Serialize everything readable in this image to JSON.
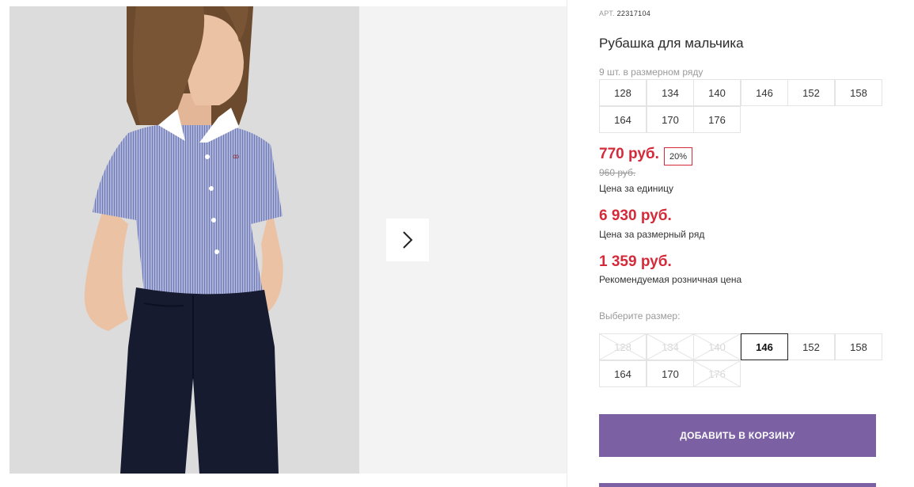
{
  "product": {
    "sku_label": "АРТ.",
    "sku_value": "22317104",
    "title": "Рубашка для мальчика",
    "pack_note": "9 шт. в размерном ряду",
    "pack_sizes": [
      "128",
      "134",
      "140",
      "146",
      "152",
      "158",
      "164",
      "170",
      "176"
    ],
    "unit_price": "770 руб.",
    "discount": "20%",
    "old_price": "960 руб.",
    "unit_price_caption": "Цена за единицу",
    "pack_price": "6 930 руб.",
    "pack_price_caption": "Цена за размерный ряд",
    "retail_price": "1 359 руб.",
    "retail_price_caption": "Рекомендуемая розничная цена",
    "choose_size_label": "Выберите размер:",
    "size_options": [
      {
        "label": "128",
        "state": "disabled"
      },
      {
        "label": "134",
        "state": "disabled"
      },
      {
        "label": "140",
        "state": "disabled"
      },
      {
        "label": "146",
        "state": "selected"
      },
      {
        "label": "152",
        "state": "available"
      },
      {
        "label": "158",
        "state": "available"
      },
      {
        "label": "164",
        "state": "available"
      },
      {
        "label": "170",
        "state": "available"
      },
      {
        "label": "176",
        "state": "disabled"
      }
    ],
    "add_to_cart": "ДОБАВИТЬ В КОРЗИНУ"
  },
  "colors": {
    "accent_purple": "#7b61a4",
    "price_red": "#d42a3a",
    "shirt_blue": "#8e97c8",
    "pants_navy": "#161b30"
  },
  "icons": {
    "next": "chevron-right-icon"
  }
}
